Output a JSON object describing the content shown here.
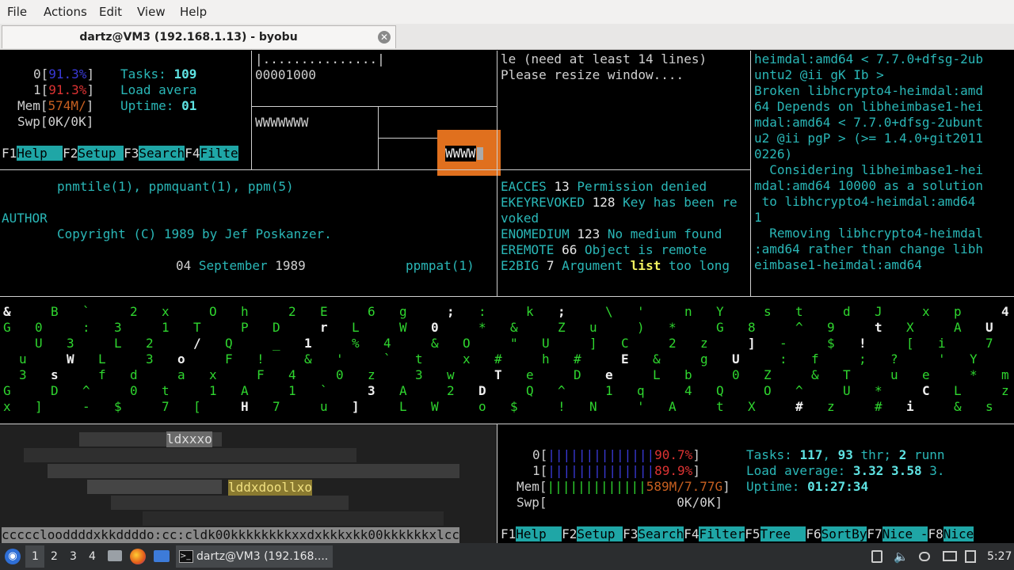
{
  "menubar": {
    "items": [
      "File",
      "Actions",
      "Edit",
      "View",
      "Help"
    ]
  },
  "tab": {
    "title": "dartz@VM3 (192.168.1.13) - byobu"
  },
  "top_left_htop": {
    "cpu0": "91.3%",
    "cpu1": "91.3%",
    "mem": "574M/",
    "swp": "0K/0K",
    "tasks_label": "Tasks:",
    "tasks_value": "109",
    "load_label": "Load avera",
    "uptime_label": "Uptime:",
    "uptime_value": "01",
    "fkeys": [
      {
        "key": "F1",
        "label": "Help  "
      },
      {
        "key": "F2",
        "label": "Setup "
      },
      {
        "key": "F3",
        "label": "Search"
      },
      {
        "key": "F4",
        "label": "Filte"
      }
    ]
  },
  "top_mid": {
    "dots": "|...............|",
    "num": "00001000",
    "ws1": "WWWWWWW",
    "ws2": "WWWW"
  },
  "resize_msg": {
    "line1": "le (need at least 14 lines)",
    "line2": "Please resize window...."
  },
  "man_page": {
    "see_also": "pnmtile(1), ppmquant(1), ppm(5)",
    "author_heading": "AUTHOR",
    "copyright": "Copyright (C) 1989 by Jef Poskanzer.",
    "footer_date_day": "04",
    "footer_date_month": "September",
    "footer_date_year": "1989",
    "footer_page": "ppmpat(1)"
  },
  "errno": {
    "lines": [
      [
        "EACCES",
        "13",
        "Permission denied"
      ],
      [
        "EKEYREVOKED",
        "128",
        "Key has been re"
      ],
      [
        "",
        "",
        "voked"
      ],
      [
        "ENOMEDIUM",
        "123",
        "No medium found"
      ],
      [
        "EREMOTE",
        "66",
        "Object is remote"
      ]
    ],
    "e2big_name": "E2BIG",
    "e2big_num": "7",
    "e2big_a": "Argument",
    "e2big_b": "list",
    "e2big_c": "too long"
  },
  "apt_log": {
    "lines": [
      "heimdal:amd64 < 7.7.0+dfsg-2ub",
      "untu2 @ii gK Ib >",
      "Broken libhcrypto4-heimdal:amd",
      "64 Depends on libheimbase1-hei",
      "mdal:amd64 < 7.7.0+dfsg-2ubunt",
      "u2 @ii pgP > (>= 1.4.0+git2011",
      "0226)",
      "  Considering libheimbase1-hei",
      "mdal:amd64 10000 as a solution",
      " to libhcrypto4-heimdal:amd64",
      "1",
      "  Removing libhcrypto4-heimdal",
      ":amd64 rather than change libh",
      "eimbase1-heimdal:amd64"
    ]
  },
  "ascii_art": {
    "frag1": "ldxxxo",
    "frag2": "lddxdoollxo",
    "bottom_line": "ccccclooddddxkkddddo:cc:cldk00kkkkkkkkxxdxkkkxkk00kkkkkkxlcc"
  },
  "htop_bottom": {
    "cpu0_label": "0",
    "cpu0_bar": "||||||||||||||",
    "cpu0_pct": "90.7%",
    "cpu1_label": "1",
    "cpu1_bar": "||||||||||||||",
    "cpu1_pct": "89.9%",
    "mem_label": "Mem",
    "mem_bar": "|||||||||||||",
    "mem_val": "589M/7.77G",
    "swp_label": "Swp",
    "swp_val": "0K/0K",
    "tasks_label": "Tasks:",
    "tasks_num": "117",
    "tasks_thr": "93",
    "tasks_thr_label": "thr;",
    "tasks_run": "2",
    "tasks_run_label": "runn",
    "load_label": "Load average:",
    "load1": "3.32",
    "load5": "3.58",
    "load15": "3.",
    "uptime_label": "Uptime:",
    "uptime": "01:27:34",
    "fkeys": [
      {
        "key": "F1",
        "label": "Help  "
      },
      {
        "key": "F2",
        "label": "Setup "
      },
      {
        "key": "F3",
        "label": "Search"
      },
      {
        "key": "F4",
        "label": "Filter"
      },
      {
        "key": "F5",
        "label": "Tree  "
      },
      {
        "key": "F6",
        "label": "SortBy"
      },
      {
        "key": "F7",
        "label": "Nice -"
      },
      {
        "key": "F8",
        "label": "Nice"
      }
    ]
  },
  "taskbar": {
    "workspaces": [
      "1",
      "2",
      "3",
      "4"
    ],
    "window_title": "dartz@VM3 (192.168....",
    "clock": "5:27"
  },
  "colors": {
    "accent_cyan": "#2ab7b7",
    "highlight_orange": "#e0701e",
    "matrix_green": "#2fd62f"
  }
}
